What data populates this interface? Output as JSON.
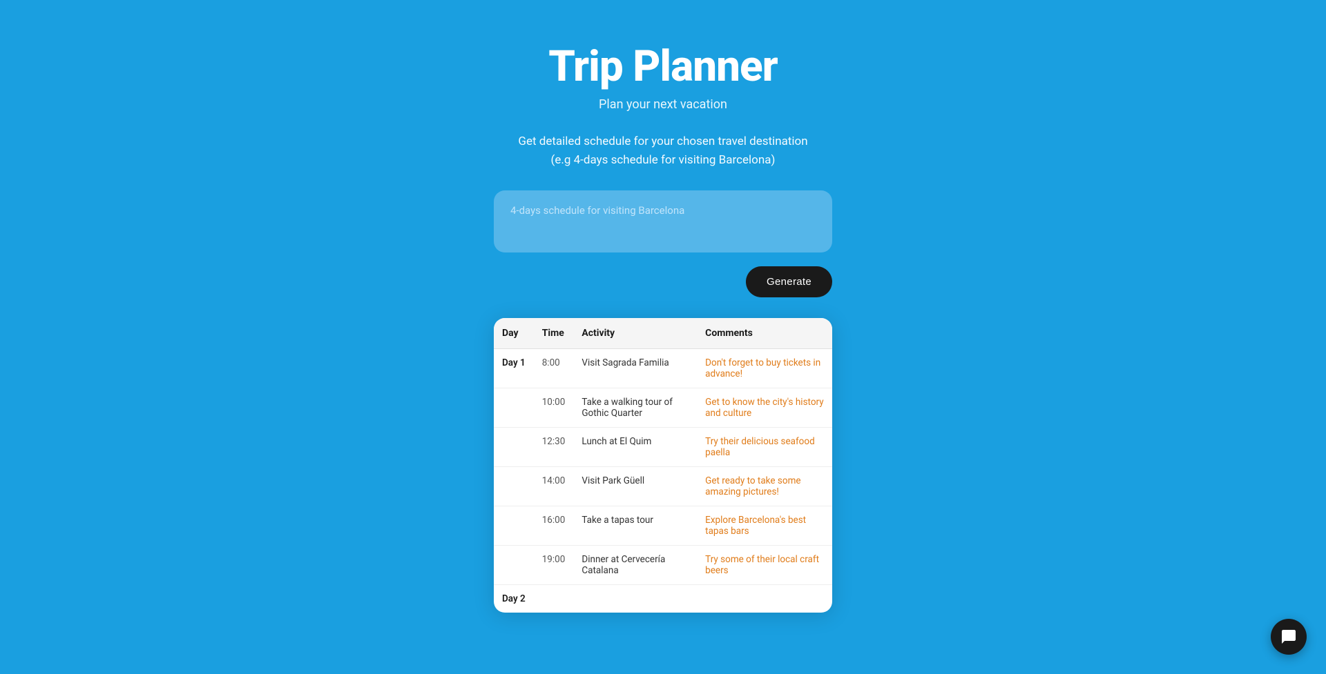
{
  "header": {
    "title": "Trip Planner",
    "subtitle": "Plan your next vacation",
    "description_line1": "Get detailed schedule for your chosen travel destination",
    "description_line2": "(e.g 4-days schedule for visiting Barcelona)"
  },
  "input": {
    "placeholder": "4-days schedule for visiting Barcelona",
    "value": ""
  },
  "buttons": {
    "generate_label": "Generate"
  },
  "table": {
    "columns": [
      "Day",
      "Time",
      "Activity",
      "Comments"
    ],
    "rows": [
      {
        "day": "Day 1",
        "time": "8:00",
        "activity": "Visit Sagrada Familia",
        "comments": "Don't forget to buy tickets in advance!"
      },
      {
        "day": "",
        "time": "10:00",
        "activity": "Take a walking tour of Gothic Quarter",
        "comments": "Get to know the city's history and culture"
      },
      {
        "day": "",
        "time": "12:30",
        "activity": "Lunch at El Quim",
        "comments": "Try their delicious seafood paella"
      },
      {
        "day": "",
        "time": "14:00",
        "activity": "Visit Park Güell",
        "comments": "Get ready to take some amazing pictures!"
      },
      {
        "day": "",
        "time": "16:00",
        "activity": "Take a tapas tour",
        "comments": "Explore Barcelona's best tapas bars"
      },
      {
        "day": "",
        "time": "19:00",
        "activity": "Dinner at Cervecería Catalana",
        "comments": "Try some of their local craft beers"
      },
      {
        "day": "Day 2",
        "time": "",
        "activity": "",
        "comments": ""
      }
    ]
  },
  "colors": {
    "background": "#1a9fe0",
    "table_bg": "#ffffff",
    "button_bg": "#1a1a1a",
    "comment_color": "#e07c1a"
  }
}
